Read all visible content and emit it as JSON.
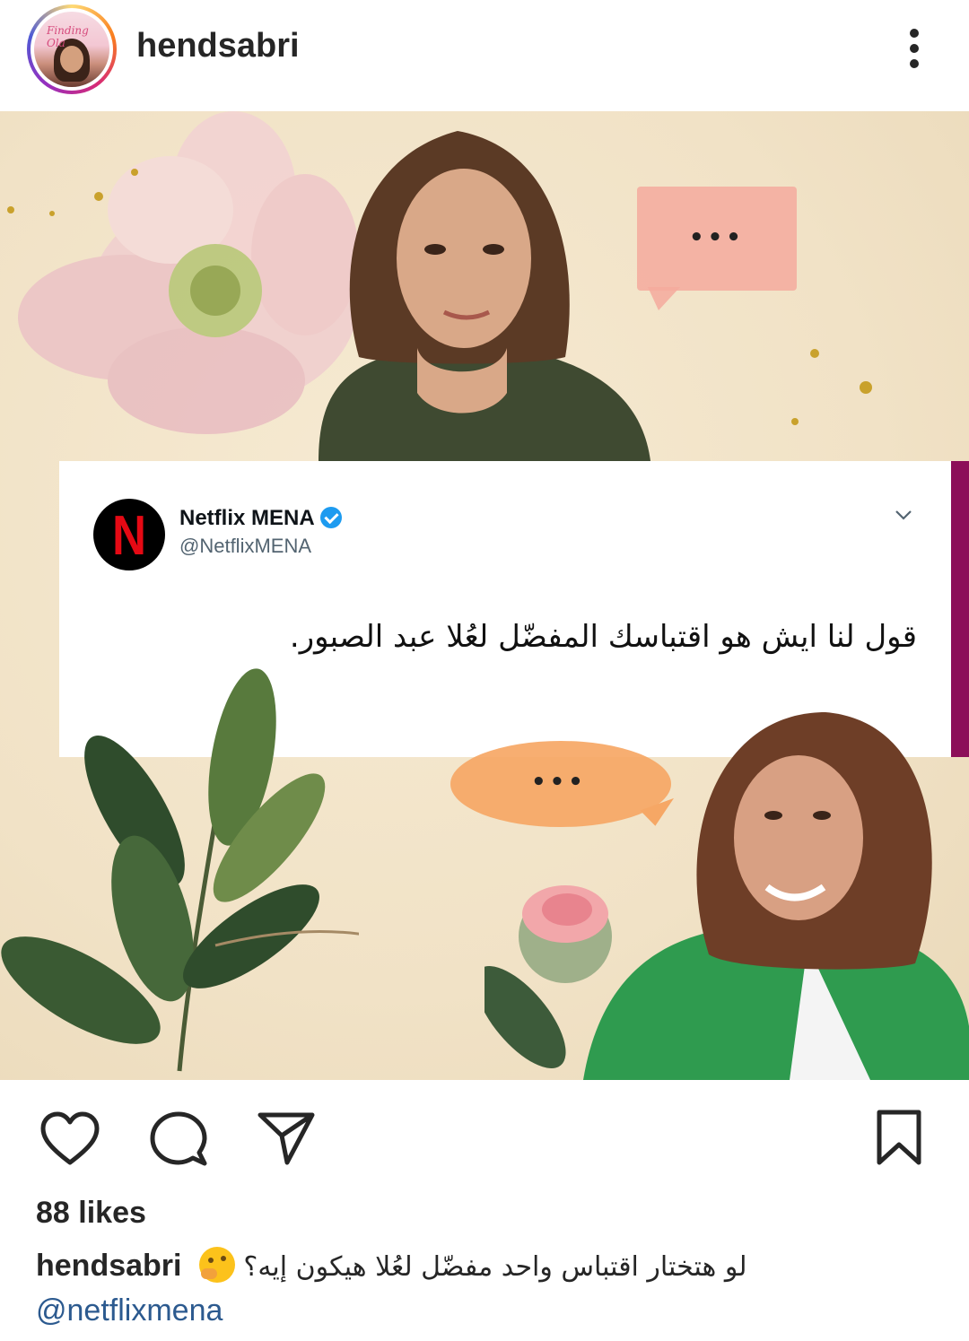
{
  "header": {
    "username": "hendsabri"
  },
  "tweet": {
    "name": "Netflix MENA",
    "handle": "@NetflixMENA",
    "logo_letter": "N",
    "text": "قول لنا ايش هو اقتباسك المفضّل لعُلا عبد الصبور."
  },
  "bubbles": {
    "pink_dots": "•••",
    "orange_dots": "•••"
  },
  "post": {
    "likes": "88 likes",
    "caption_user": "hendsabri",
    "caption_text": "لو هتختار اقتباس واحد مفضّل لعُلا هيكون إيه؟",
    "mention": "@netflixmena"
  },
  "icons": {
    "like": "heart-icon",
    "comment": "comment-icon",
    "share": "send-icon",
    "save": "bookmark-icon",
    "more": "more-vertical-icon",
    "verified": "verified-badge-icon",
    "emoji": "thinking-face-emoji"
  },
  "colors": {
    "netflix_red": "#e50914",
    "twitter_blue": "#1d9bf0",
    "accent_bar": "#8c0f59",
    "link": "#2c5a8f"
  }
}
